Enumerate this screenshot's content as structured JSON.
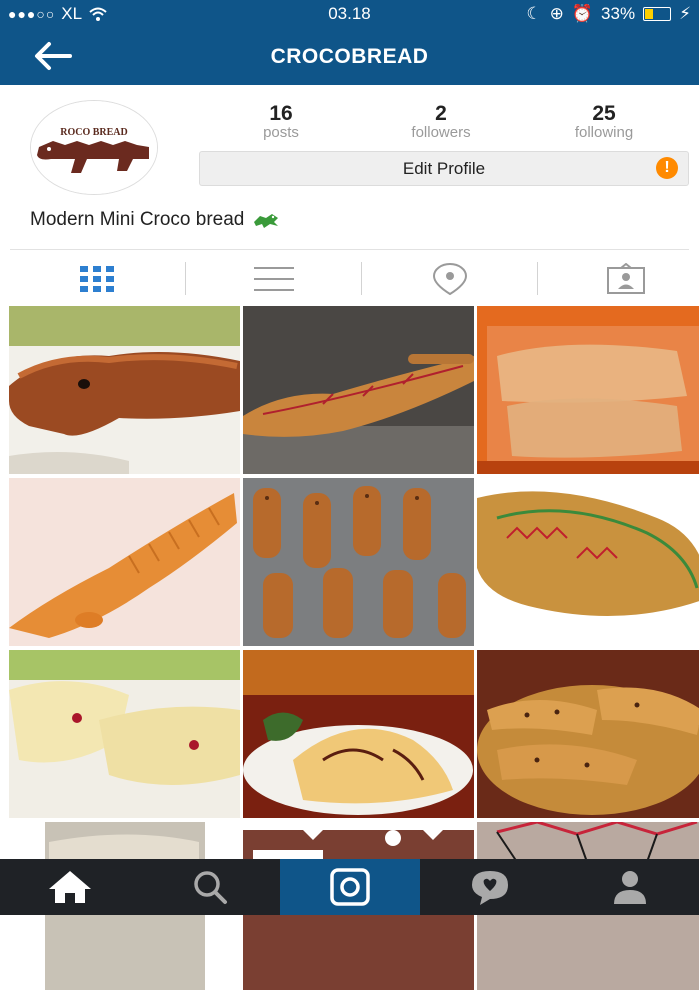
{
  "status_bar": {
    "carrier": "XL",
    "time": "03.18",
    "battery": "33%",
    "battery_level": 0.33
  },
  "header": {
    "title": "CROCOBREAD"
  },
  "profile": {
    "avatar_text": "ROCO BREAD",
    "stats": [
      {
        "value": "16",
        "label": "posts"
      },
      {
        "value": "2",
        "label": "followers"
      },
      {
        "value": "25",
        "label": "following"
      }
    ],
    "edit_button_label": "Edit Profile",
    "alert_icon": "!",
    "bio": "Modern Mini Croco bread"
  },
  "view_tabs": [
    {
      "icon": "grid-icon",
      "active": true
    },
    {
      "icon": "list-icon",
      "active": false
    },
    {
      "icon": "location-pin-icon",
      "active": false
    },
    {
      "icon": "tagged-photos-icon",
      "active": false
    }
  ],
  "colors": {
    "brand_blue": "#0f5589",
    "active_tab_blue": "#2d7fd0",
    "alert_orange": "#ff8a00",
    "nav_dark": "#1f2226"
  },
  "posts": [
    {
      "name": "croco-bread-brown-glazed"
    },
    {
      "name": "croco-bread-icing-red"
    },
    {
      "name": "croco-bread-packaged-tray"
    },
    {
      "name": "croco-bread-orange-ridged"
    },
    {
      "name": "croco-bread-baking-tray"
    },
    {
      "name": "croco-bread-decorated-large"
    },
    {
      "name": "croco-bread-white-green"
    },
    {
      "name": "croco-bread-chocolate-plate"
    },
    {
      "name": "croco-bread-basket-dotted"
    },
    {
      "name": "croco-bread-partial-1"
    },
    {
      "name": "croco-bread-partial-2"
    },
    {
      "name": "croco-bread-partial-3"
    }
  ],
  "bottom_nav": [
    {
      "icon": "home-icon",
      "active": false
    },
    {
      "icon": "search-icon",
      "active": false
    },
    {
      "icon": "camera-icon",
      "active": true
    },
    {
      "icon": "activity-bubble-icon",
      "active": false
    },
    {
      "icon": "profile-icon",
      "active": false
    }
  ]
}
